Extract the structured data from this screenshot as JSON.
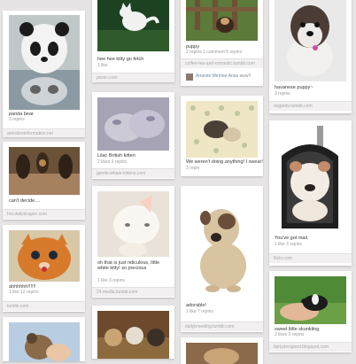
{
  "pins": [
    {
      "id": "panda",
      "desc": "panda bear",
      "meta": "3 repins",
      "source": "arerabreinformation.net"
    },
    {
      "id": "kitty-go-fetch",
      "desc": "hee hee kitty go fetch",
      "meta": "1 like",
      "source": "picnic.com"
    },
    {
      "id": "puppy-fence",
      "desc": "puppy",
      "meta": "2 repins 1 comment 6 repins",
      "source": "coffee-tea-and-romantic.tumblr.com"
    },
    {
      "id": "havanese",
      "desc": "havanese puppy~",
      "meta": "3 repins",
      "source": "dogpets.tumblr.com"
    },
    {
      "id": "lilac-kitten",
      "desc": "Lilac British kitten",
      "meta": "2 likes 3 repins",
      "source": "gentle-whale-kittens.com"
    },
    {
      "id": "weren-t-doing",
      "desc": "We weren't doing anything! I swear!",
      "meta": "1 repin",
      "source": ""
    },
    {
      "id": "cant-decide",
      "desc": "can't decide....",
      "meta": "",
      "source": "hot.dailydragon.com"
    },
    {
      "id": "white-kitty",
      "desc": "oh that is just ridiculous, little white kitty! so precious",
      "meta": "1 like 3 repins",
      "source": "24.media.tumblr.com"
    },
    {
      "id": "bulldog-mailbox",
      "desc": "You've got mail.",
      "meta": "1 like 3 repins",
      "source": "flickr.com"
    },
    {
      "id": "orange-kitten",
      "desc": "ahhhhhh!!!!!!",
      "meta": "1 like 12 repins",
      "source": "tumblr.com"
    },
    {
      "id": "bulldog-adorable",
      "desc": "adorable!",
      "meta": "1 like 7 repins",
      "source": "dailybreeding.tumblr.com"
    },
    {
      "id": "skunk",
      "desc": "sweet little skunkling.",
      "meta": "2 likes 3 repins",
      "source": "fairlydesigned.blogspot.com"
    }
  ],
  "via": {
    "user": "Arianne Merriee Arias",
    "text": "aww!!"
  },
  "colors": {
    "background": "#e6e4e4",
    "card": "#ffffff",
    "footer": "#f2f0f0"
  }
}
